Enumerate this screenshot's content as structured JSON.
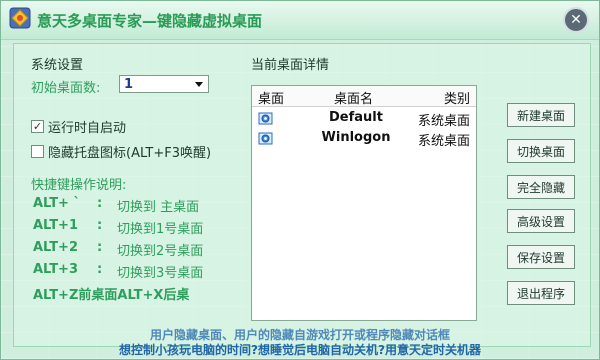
{
  "window": {
    "title": "意天多桌面专家—键隐藏虚拟桌面"
  },
  "settings": {
    "section_label": "系统设置",
    "count_label": "初始桌面数:",
    "count_value": "1",
    "autostart_label": "运行时自启动",
    "autostart_checked": true,
    "hide_tray_label": "隐藏托盘图标(ALT+F3唤醒)",
    "hide_tray_checked": false
  },
  "shortcuts": {
    "title": "快捷键操作说明:",
    "lines": [
      {
        "key": "ALT+ `",
        "sep": ":",
        "desc": "切换到 主桌面"
      },
      {
        "key": "ALT+1",
        "sep": ":",
        "desc": "切换到1号桌面"
      },
      {
        "key": "ALT+2",
        "sep": ":",
        "desc": "切换到2号桌面"
      },
      {
        "key": "ALT+3",
        "sep": ":",
        "desc": "切换到3号桌面"
      }
    ],
    "last_line": "ALT+Z前桌面ALT+X后桌"
  },
  "details": {
    "section_label": "当前桌面详情",
    "columns": [
      "桌面",
      "桌面名",
      "类别"
    ],
    "rows": [
      {
        "name": "Default",
        "type": "系统桌面"
      },
      {
        "name": "Winlogon",
        "type": "系统桌面"
      }
    ]
  },
  "buttons": {
    "new_desktop": "新建桌面",
    "switch_desktop": "切换桌面",
    "full_hide": "完全隐藏",
    "advanced": "高级设置",
    "save": "保存设置",
    "exit": "退出程序"
  },
  "footer": {
    "line1": "用户隐藏桌面、用户的隐藏自游戏打开或程序隐藏对话框",
    "line2": "想控制小孩玩电脑的时间?想睡觉后电脑自动关机?用意天定时关机器"
  }
}
